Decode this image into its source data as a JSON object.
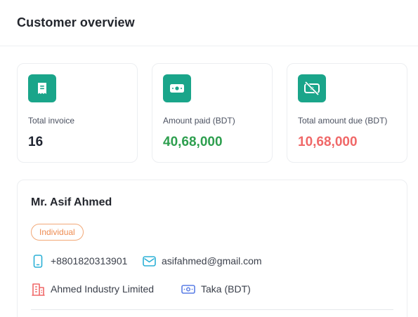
{
  "header": {
    "title": "Customer overview"
  },
  "summary_cards": [
    {
      "icon": "receipt-icon",
      "label": "Total invoice",
      "value": "16",
      "value_color": "#1f2430"
    },
    {
      "icon": "cash-icon",
      "label": "Amount paid (BDT)",
      "value": "40,68,000",
      "value_color": "#2e9f4f"
    },
    {
      "icon": "cash-off-icon",
      "label": "Total amount due (BDT)",
      "value": "10,68,000",
      "value_color": "#f06868"
    }
  ],
  "customer": {
    "name": "Mr. Asif Ahmed",
    "type": "Individual",
    "phone": "+8801820313901",
    "email": "asifahmed@gmail.com",
    "company": "Ahmed Industry Limited",
    "currency": "Taka (BDT)"
  },
  "colors": {
    "accent": "#1aa58a",
    "paid": "#2e9f4f",
    "due": "#f06868",
    "badge": "#ee8c52",
    "phone_icon": "#2bb0d6",
    "company_icon": "#f06868",
    "currency_icon": "#5b7ee5"
  }
}
